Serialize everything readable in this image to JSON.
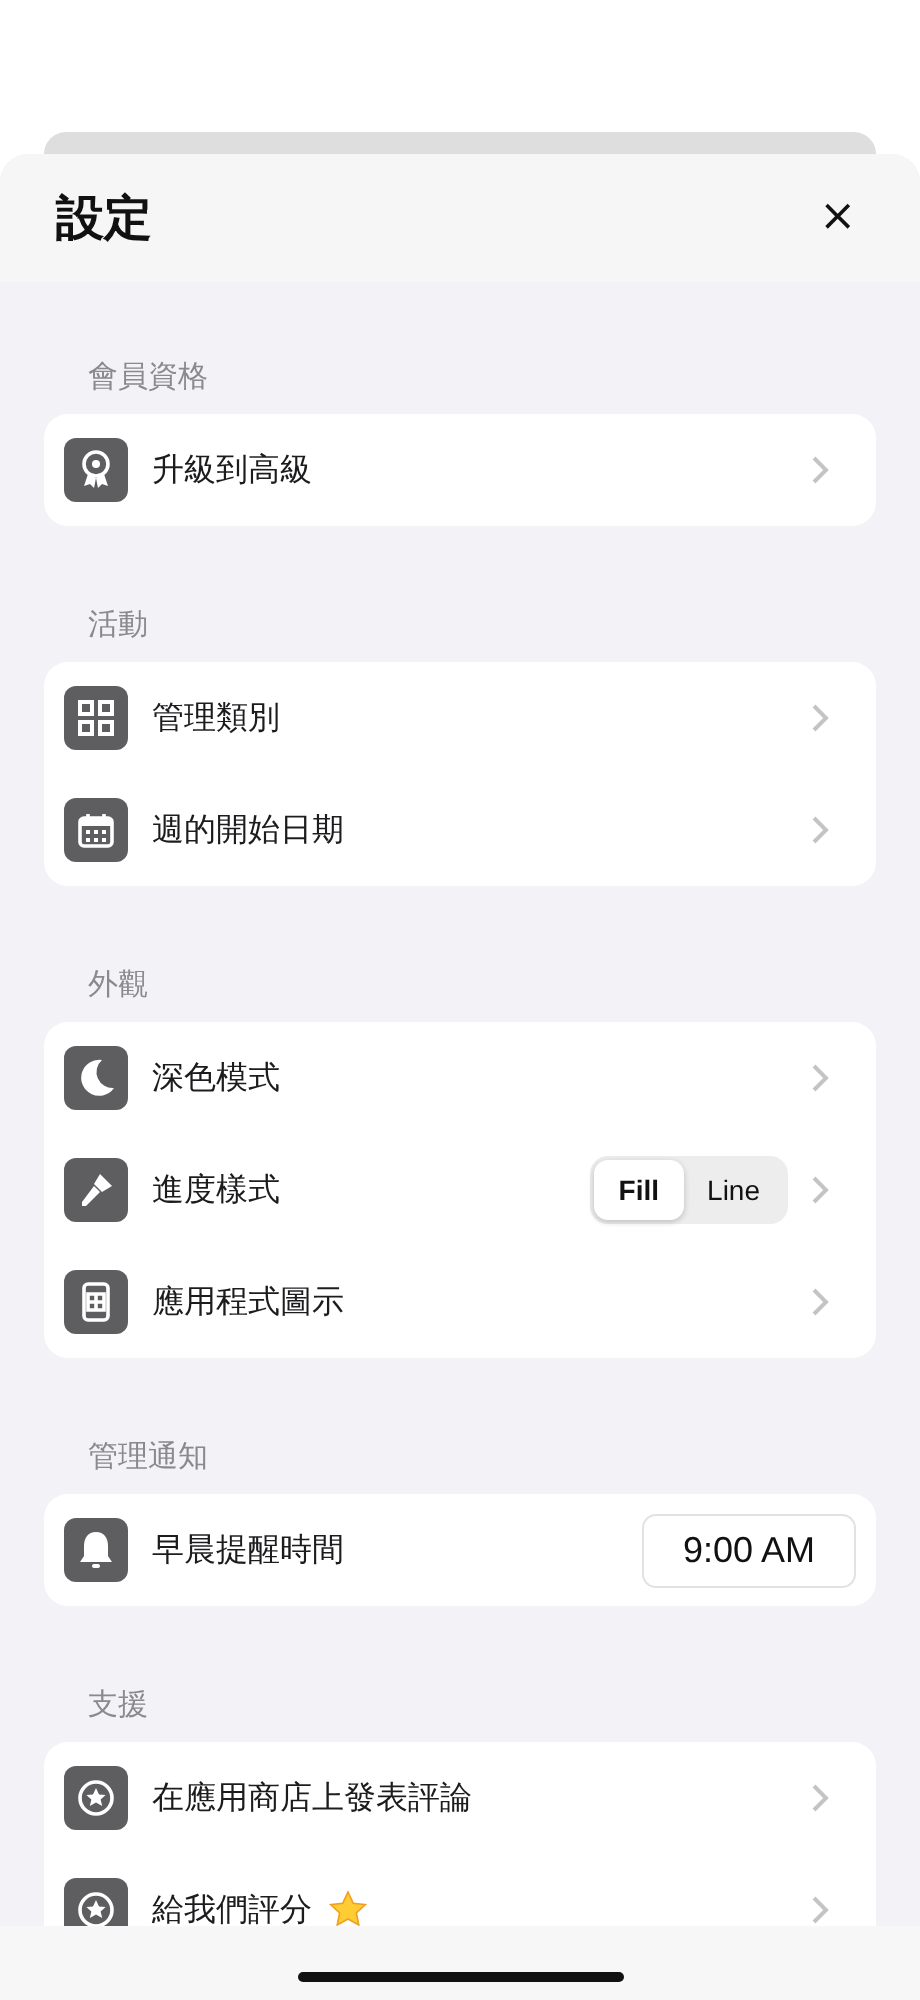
{
  "sheet": {
    "title": "設定",
    "close": "×"
  },
  "sections": [
    {
      "label": "會員資格",
      "rows": [
        {
          "kind": "link",
          "label": "升級到高級"
        }
      ]
    },
    {
      "label": "活動",
      "rows": [
        {
          "kind": "link",
          "label": "管理類別"
        },
        {
          "kind": "link",
          "label": "週的開始日期"
        }
      ]
    },
    {
      "label": "外觀",
      "rows": [
        {
          "kind": "link",
          "label": "深色模式"
        },
        {
          "kind": "segmented",
          "label": "進度樣式",
          "options": [
            {
              "label": "Fill",
              "selected": true
            },
            {
              "label": "Line",
              "selected": false
            }
          ]
        },
        {
          "kind": "link",
          "label": "應用程式圖示"
        }
      ]
    },
    {
      "label": "管理通知",
      "rows": [
        {
          "kind": "time",
          "label": "早晨提醒時間",
          "value": "9:00 AM"
        }
      ]
    },
    {
      "label": "支援",
      "rows": [
        {
          "kind": "link",
          "label": "在應用商店上發表評論"
        },
        {
          "kind": "link",
          "label": "給我們評分",
          "star": true
        }
      ]
    }
  ]
}
